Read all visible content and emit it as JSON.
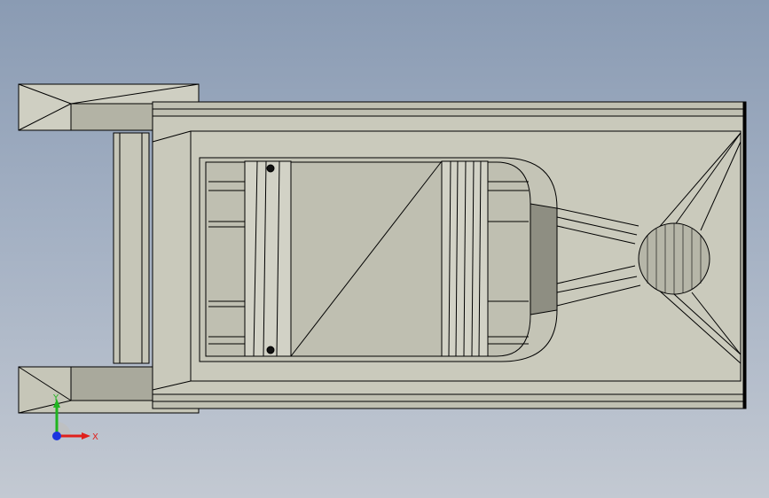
{
  "viewport": {
    "background_top": "#8a9bb3",
    "background_bottom": "#c3c9d2"
  },
  "model": {
    "fill_color": "#c6c6b8",
    "shade_color": "#a3a396",
    "edge_color": "#000000"
  },
  "triad": {
    "x_label": "X",
    "y_label": "Y",
    "x_color": "#e0201c",
    "y_color": "#1fb41f",
    "z_color": "#1c35e0"
  }
}
